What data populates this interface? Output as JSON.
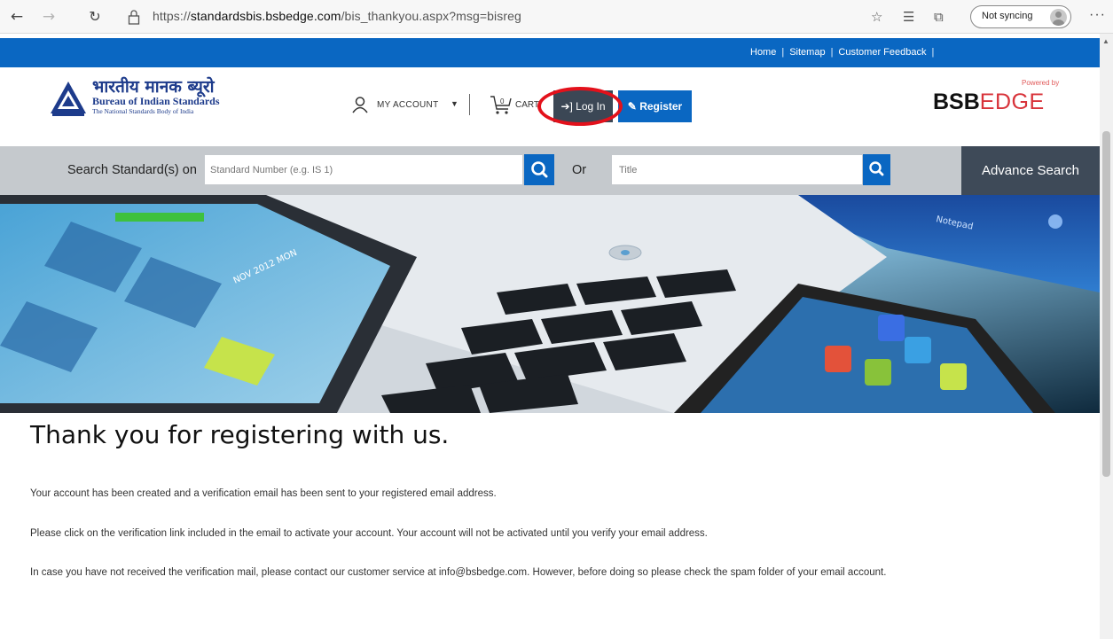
{
  "browser": {
    "url_prefix": "https://",
    "url_host": "standardsbis.bsbedge.com",
    "url_path": "/bis_thankyou.aspx?msg=bisreg",
    "sync_label": "Not syncing"
  },
  "top_links": [
    "Home",
    "Sitemap",
    "Customer Feedback"
  ],
  "branding": {
    "hindi_name": "भारतीय मानक ब्यूरो",
    "english_name": "Bureau of Indian Standards",
    "tagline": "The National Standards Body of India",
    "powered_by": "Powered by",
    "bsb": "BSB",
    "edge": "EDGE"
  },
  "header": {
    "account_label": "MY ACCOUNT",
    "cart_count": "0",
    "cart_label": "CART",
    "login_label": "Log In",
    "register_label": "Register"
  },
  "search": {
    "label": "Search Standard(s) on",
    "standard_placeholder": "Standard Number (e.g. IS 1)",
    "or_label": "Or",
    "title_placeholder": "Title",
    "advance_label": "Advance Search"
  },
  "banner": {
    "notepad": "Notepad",
    "date": "NOV 2012 MON"
  },
  "content": {
    "title": "Thank you for registering with us.",
    "para1": "Your account has been created and a verification email has been sent to your registered email address.",
    "para2": "Please click on the verification link included in the email to activate your account. Your account will not be activated until you verify your email address.",
    "para3": "In case you have not received the verification mail, please contact our customer service at info@bsbedge.com. However, before doing so please check the spam folder of your email account."
  },
  "colors": {
    "brand_blue": "#0a67c2",
    "login_gray": "#3b4755",
    "highlight_red": "#e3111b"
  }
}
